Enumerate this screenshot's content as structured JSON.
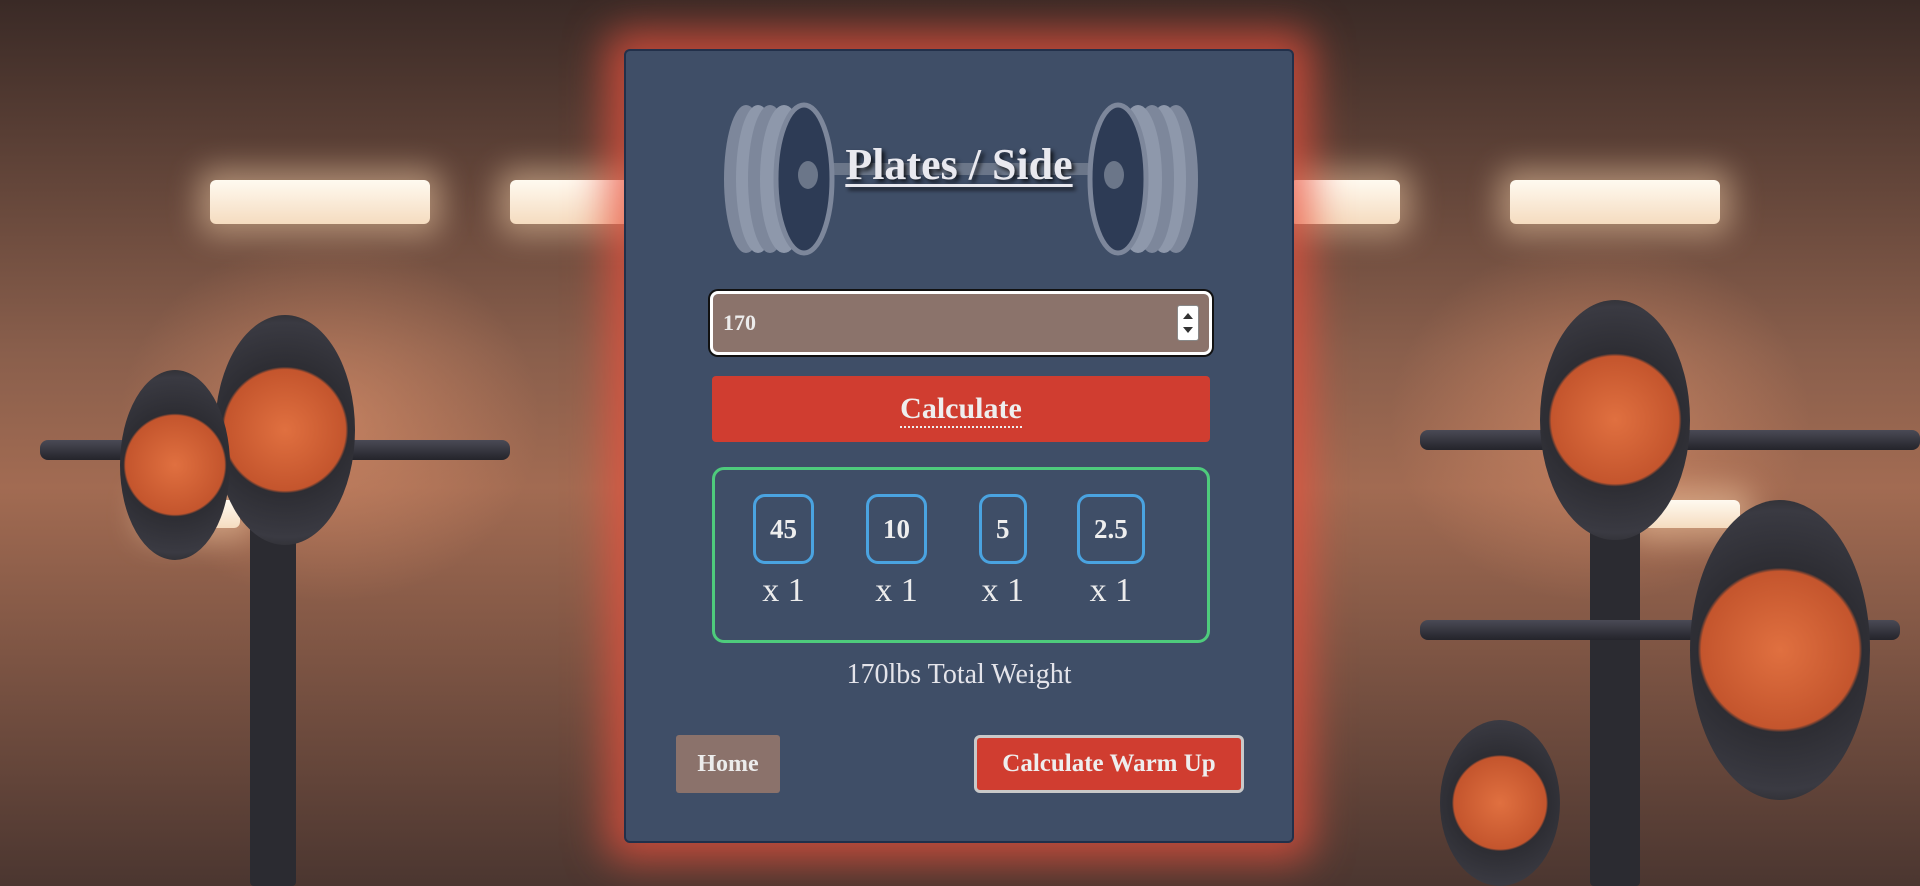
{
  "app": {
    "title": "Plates / Side"
  },
  "weight_input": {
    "value": "170",
    "type": "number"
  },
  "buttons": {
    "calculate": "Calculate",
    "home": "Home",
    "warm_up": "Calculate Warm Up"
  },
  "plates": [
    {
      "weight": "45",
      "count": "x 1"
    },
    {
      "weight": "10",
      "count": "x 1"
    },
    {
      "weight": "5",
      "count": "x 1"
    },
    {
      "weight": "2.5",
      "count": "x 1"
    }
  ],
  "total": {
    "text": "170lbs Total Weight"
  },
  "colors": {
    "panel": "#3f4e67",
    "accent_red": "#d03d30",
    "plate_border_blue": "#4aa3e0",
    "results_border_green": "#4ecb7c",
    "input_bg": "#8b736b"
  },
  "icons": {
    "logo": "barbell-icon",
    "background": "gym-background-image"
  }
}
